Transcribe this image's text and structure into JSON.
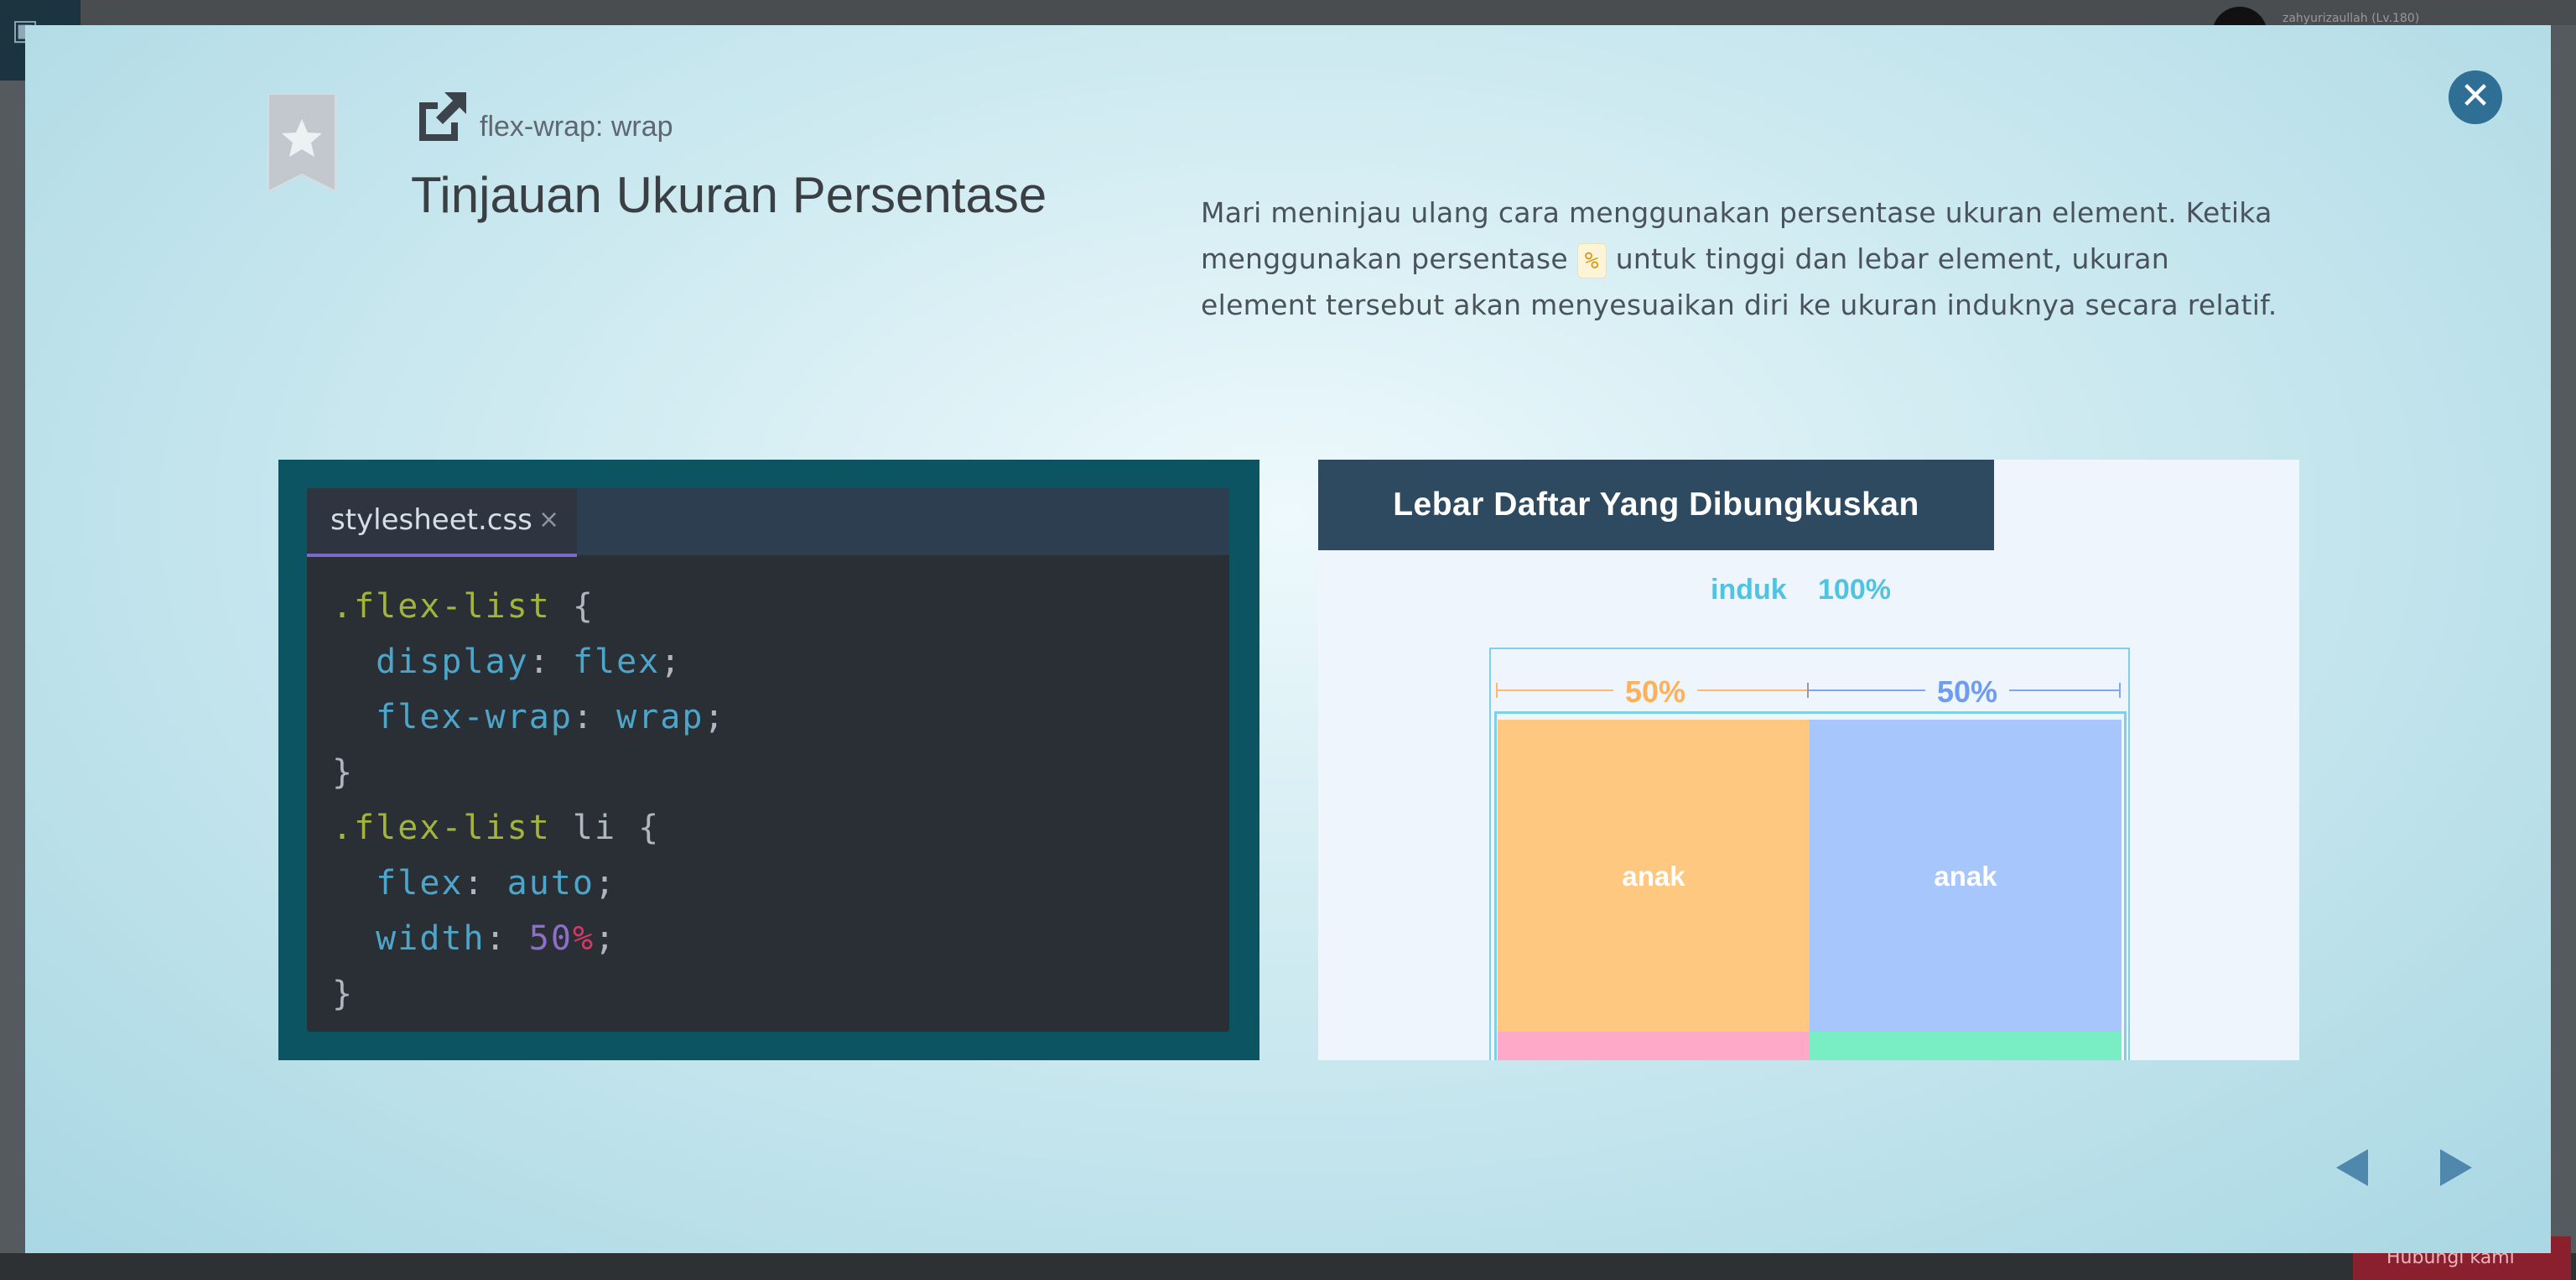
{
  "background": {
    "user_name": "zahyurizaullah (Lv.180)",
    "bottom_button": "Hubungi kami"
  },
  "modal": {
    "close_icon": "close-icon",
    "lesson": {
      "tag": "flex-wrap: wrap",
      "title": "Tinjauan Ukuran Persentase"
    },
    "description": {
      "part1": "Mari meninjau ulang cara menggunakan persentase ukuran element. Ketika menggunakan persentase ",
      "code": "%",
      "part2": " untuk tinggi dan lebar element, ukuran element tersebut akan menyesuaikan diri ke ukuran induknya secara relatif."
    },
    "editor": {
      "tab_name": "stylesheet.css",
      "tab_close": "×",
      "lines": [
        {
          "sel": ".flex-list",
          "rest": " {"
        },
        {
          "prop": "display",
          "val": "flex"
        },
        {
          "prop": "flex-wrap",
          "val": "wrap"
        },
        {
          "close": "}"
        },
        {
          "sel": ".flex-list",
          "rest": " li {"
        },
        {
          "prop": "flex",
          "val": "auto"
        },
        {
          "prop": "width",
          "num": "50",
          "unit": "%"
        },
        {
          "close": "}"
        }
      ]
    },
    "illustration": {
      "title": "Lebar Daftar Yang Dibungkuskan",
      "parent_label": "induk",
      "parent_pct": "100%",
      "left_width": "50%",
      "right_width": "50%",
      "child_label_1": "anak",
      "child_label_2": "anak",
      "colors": {
        "orange": "#ffc880",
        "blue": "#a7c6fb",
        "pink": "#ffa9c9",
        "green": "#79edc4",
        "accent": "#4fc3e0"
      }
    },
    "nav": {
      "prev": "previous-arrow-icon",
      "next": "next-arrow-icon"
    }
  }
}
